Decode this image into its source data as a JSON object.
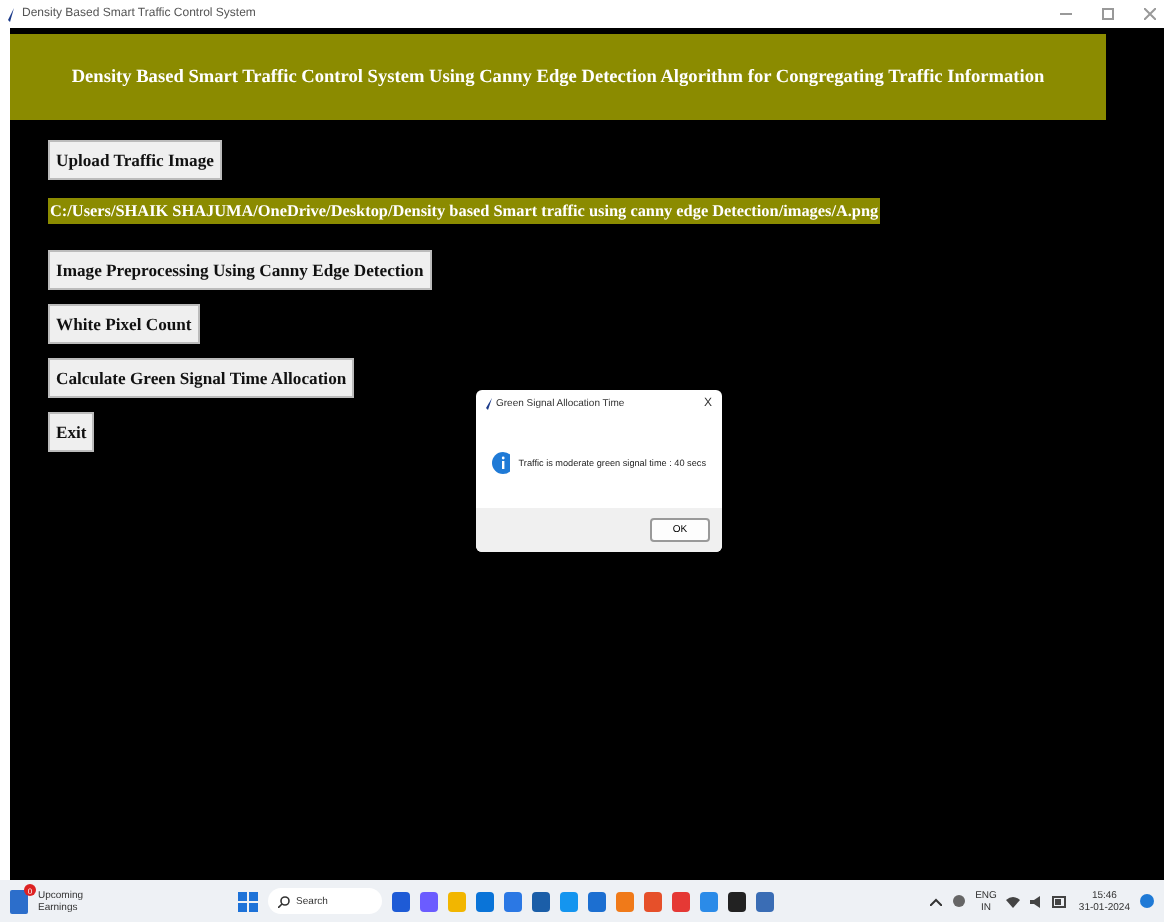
{
  "window": {
    "title": "Density Based Smart Traffic Control System"
  },
  "banner": {
    "text": "Density Based Smart Traffic Control System Using Canny Edge Detection Algorithm for Congregating Traffic Information"
  },
  "controls": [
    {
      "kind": "button",
      "label": "Upload Traffic Image"
    },
    {
      "kind": "path",
      "label": "C:/Users/SHAIK SHAJUMA/OneDrive/Desktop/Density based Smart traffic using canny edge Detection/images/A.png"
    },
    {
      "kind": "button",
      "label": "Image Preprocessing Using Canny Edge Detection"
    },
    {
      "kind": "button",
      "label": "White Pixel Count"
    },
    {
      "kind": "button",
      "label": "Calculate Green Signal Time Allocation"
    },
    {
      "kind": "button",
      "label": "Exit"
    }
  ],
  "dialog": {
    "title": "Green Signal Allocation Time",
    "close": "X",
    "message": "Traffic is moderate green signal time : 40 secs",
    "button": "OK"
  },
  "taskbar": {
    "widget_badge": "0",
    "widget_title": "Upcoming",
    "widget_subtitle": "Earnings",
    "search_placeholder": "Search",
    "language": "ENG",
    "region": "IN",
    "time": "15:46",
    "date": "31-01-2024"
  }
}
